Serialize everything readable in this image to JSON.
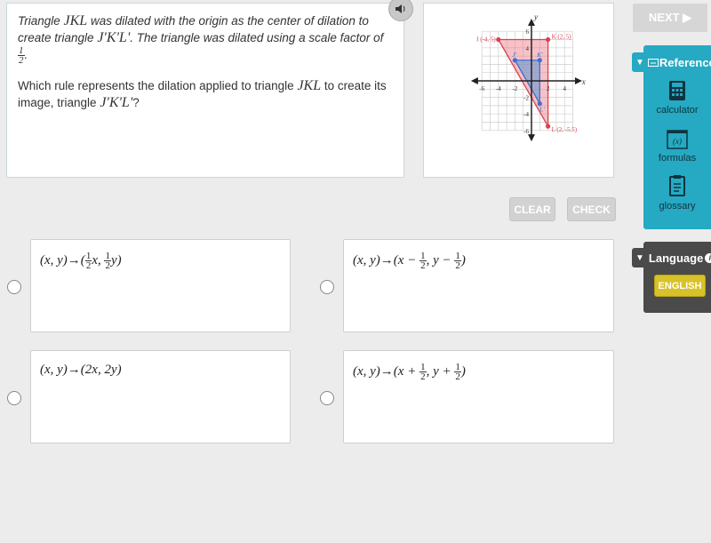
{
  "question": {
    "p1_a": "Triangle ",
    "p1_jkl": "JKL",
    "p1_b": " was dilated with the origin as the center of dilation to create triangle ",
    "p1_prime": "J'K'L'",
    "p1_c": ". The triangle was dilated using a scale factor of",
    "scale_num": "1",
    "scale_den": "2",
    "p2_a": "Which rule represents the dilation applied to triangle ",
    "p2_jkl": "JKL",
    "p2_b": " to create its image, triangle ",
    "p2_prime": "J'K'L'",
    "p2_c": "?"
  },
  "audio": {
    "icon": "speaker-icon"
  },
  "graph": {
    "x_ticks": [
      "-6",
      "-4",
      "-2",
      "2",
      "4"
    ],
    "y_ticks": [
      "6",
      "4",
      "-2",
      "-4",
      "-6"
    ],
    "x_label": "x",
    "y_label": "y",
    "original": {
      "color": "#d9424f",
      "points": [
        {
          "name": "J",
          "x": -4,
          "y": 5,
          "label": "J (-4, 5)"
        },
        {
          "name": "K",
          "x": 2,
          "y": 5,
          "label": "K (2, 5)"
        },
        {
          "name": "L",
          "x": 2,
          "y": -5.5,
          "label": "L (2, -5.5)"
        }
      ]
    },
    "image": {
      "color": "#3f6fcf",
      "points": [
        {
          "name": "J'",
          "x": -2,
          "y": 2.5,
          "label": "J'"
        },
        {
          "name": "K'",
          "x": 1,
          "y": 2.5,
          "label": "K'"
        },
        {
          "name": "L'",
          "x": 1,
          "y": -2.75,
          "label": "L'"
        }
      ]
    }
  },
  "nav": {
    "next_label": "NEXT ▶"
  },
  "reference": {
    "title": "Reference",
    "tools": [
      {
        "label": "calculator",
        "icon": "calculator-icon"
      },
      {
        "label": "formulas",
        "icon": "formulas-icon"
      },
      {
        "label": "glossary",
        "icon": "glossary-icon"
      }
    ]
  },
  "language": {
    "title": "Language",
    "button": "ENGLISH"
  },
  "actions": {
    "clear": "CLEAR",
    "check": "CHECK"
  },
  "options": [
    {
      "id": "A",
      "prefix": "(x, y)→(",
      "parts": [
        "½x, ½y"
      ]
    },
    {
      "id": "B"
    },
    {
      "id": "C",
      "text": "(x, y)→(2x, 2y)"
    },
    {
      "id": "D"
    }
  ],
  "option_text": {
    "o1_a": "(x, y)→(",
    "o1_b": "x, ",
    "o1_c": "y)",
    "o2_a": "(x, y)→(x − ",
    "o2_b": ", y − ",
    "o2_c": ")",
    "o3": "(x, y)→(2x, 2y)",
    "o4_a": "(x, y)→(x + ",
    "o4_b": ", y + ",
    "o4_c": ")",
    "half_num": "1",
    "half_den": "2"
  }
}
